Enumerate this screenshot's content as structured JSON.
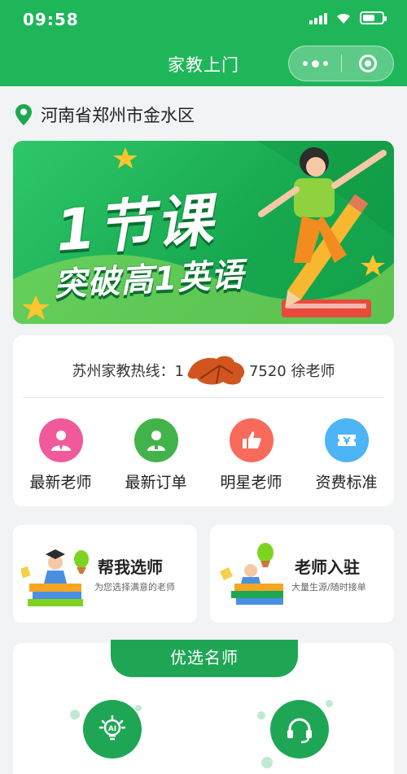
{
  "status_bar": {
    "time": "09:58"
  },
  "nav": {
    "title": "家教上门"
  },
  "location": {
    "text": "河南省郑州市金水区"
  },
  "banner": {
    "line1": "1节课",
    "line2": "突破高1英语"
  },
  "hotline": {
    "text": "苏州家教热线：1",
    "suffix": "7520 徐老师"
  },
  "menu": [
    {
      "label": "最新老师",
      "icon": "user-tie-icon",
      "color": "#f15a9a"
    },
    {
      "label": "最新订单",
      "icon": "person-icon",
      "color": "#42b34a"
    },
    {
      "label": "明星老师",
      "icon": "thumbs-up-icon",
      "color": "#f86a5a"
    },
    {
      "label": "资费标准",
      "icon": "ticket-yen-icon",
      "color": "#4db4f5"
    }
  ],
  "cards": [
    {
      "title": "帮我选师",
      "desc": "为您选择满意的老师"
    },
    {
      "title": "老师入驻",
      "desc": "大量生源/随时接单"
    }
  ],
  "featured": {
    "title": "优选名师",
    "icons": [
      "ai-lightbulb-icon",
      "headset-icon"
    ]
  },
  "colors": {
    "brand": "#1fb65a",
    "brand_dark": "#1fa655",
    "page_bg": "#f2f3f5"
  }
}
